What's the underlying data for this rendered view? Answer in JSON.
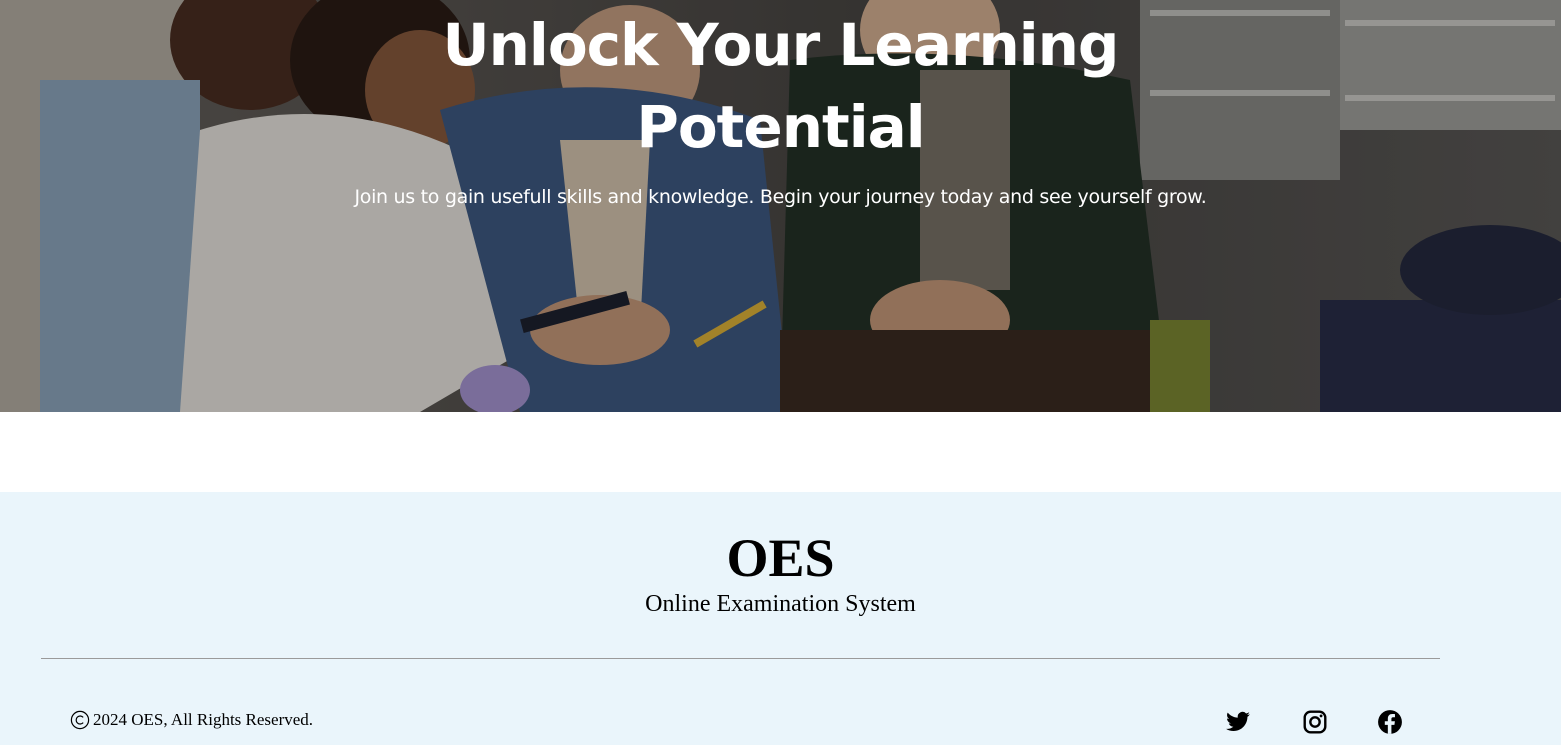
{
  "hero": {
    "title_line1": "Unlock Your Learning",
    "title_line2": "Potential",
    "subtitle": "Join us to gain usefull skills and knowledge. Begin your journey today and see yourself grow."
  },
  "footer": {
    "brand": "OES",
    "tagline": "Online Examination System",
    "copyright": "2024 OES, All Rights Reserved.",
    "background_color": "#eaf5fb",
    "socials": [
      {
        "icon": "twitter-icon"
      },
      {
        "icon": "instagram-icon"
      },
      {
        "icon": "facebook-icon"
      }
    ]
  }
}
